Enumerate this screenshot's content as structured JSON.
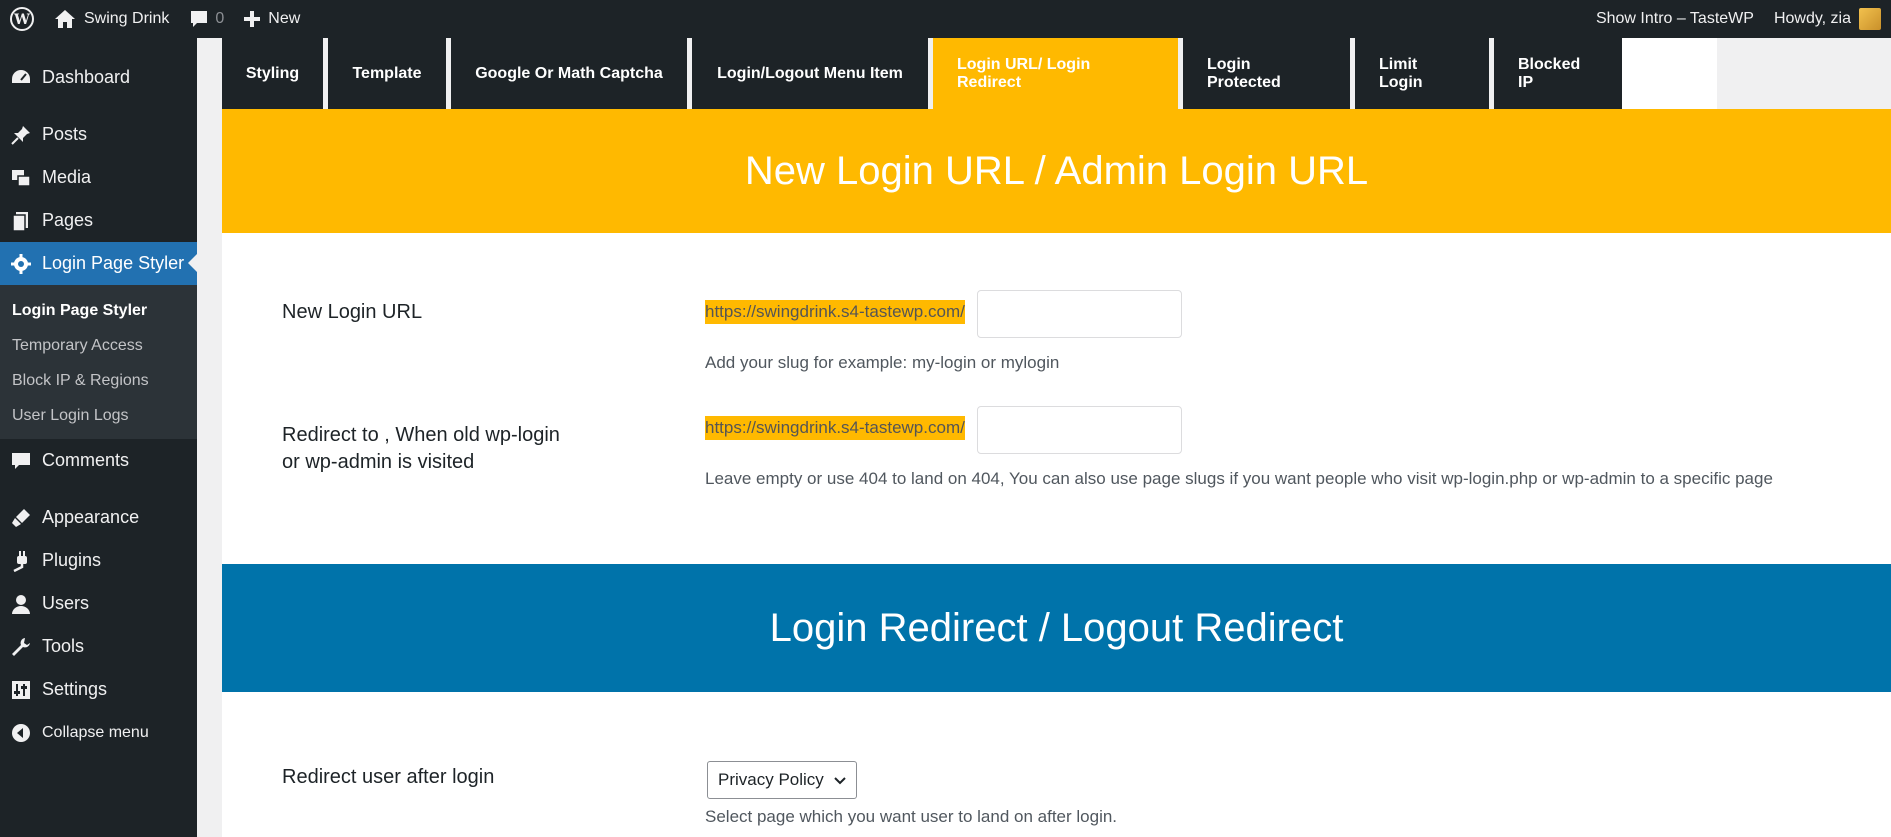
{
  "adminbar": {
    "site_name": "Swing Drink",
    "comments_count": "0",
    "new_label": "New",
    "show_intro": "Show Intro – TasteWP",
    "howdy": "Howdy, zia"
  },
  "sidebar": {
    "items": [
      {
        "label": "Dashboard"
      },
      {
        "label": "Posts"
      },
      {
        "label": "Media"
      },
      {
        "label": "Pages"
      },
      {
        "label": "Login Page Styler"
      },
      {
        "label": "Comments"
      },
      {
        "label": "Appearance"
      },
      {
        "label": "Plugins"
      },
      {
        "label": "Users"
      },
      {
        "label": "Tools"
      },
      {
        "label": "Settings"
      },
      {
        "label": "Collapse menu"
      }
    ],
    "submenu": [
      {
        "label": "Login Page Styler"
      },
      {
        "label": "Temporary Access"
      },
      {
        "label": "Block IP & Regions"
      },
      {
        "label": "User Login Logs"
      }
    ]
  },
  "tabs": [
    {
      "label": "Styling"
    },
    {
      "label": "Template"
    },
    {
      "label": "Google Or Math Captcha"
    },
    {
      "label": "Login/Logout Menu Item"
    },
    {
      "label": "Login URL/ Login Redirect"
    },
    {
      "label": "Login Protected"
    },
    {
      "label": "Limit Login"
    },
    {
      "label": "Blocked IP"
    }
  ],
  "section1": {
    "title": "New Login URL / Admin Login URL",
    "new_login_label": "New Login URL",
    "url_prefix": "https://swingdrink.s4-tastewp.com/",
    "new_login_value": "",
    "new_login_desc": "Add your slug for example: my-login or mylogin",
    "redirect_label": "Redirect to , When old wp-login or wp-admin is visited",
    "redirect_value": "",
    "redirect_desc": "Leave empty or use 404 to land on 404, You can also use page slugs if you want people who visit wp-login.php or wp-admin to a specific page"
  },
  "section2": {
    "title": "Login Redirect / Logout Redirect",
    "after_login_label": "Redirect user after login",
    "after_login_selected": "Privacy Policy",
    "after_login_desc": "Select page which you want user to land on after login."
  },
  "colors": {
    "accent_yellow": "#ffb900",
    "accent_blue": "#0073aa",
    "admin_dark": "#1d2327",
    "active_menu": "#2271b1"
  }
}
